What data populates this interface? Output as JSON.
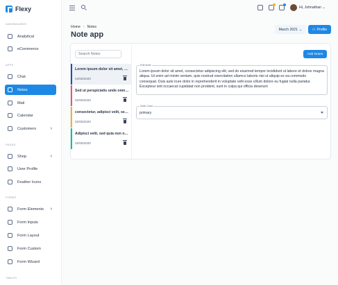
{
  "app": {
    "name": "Flexy"
  },
  "sidebar": {
    "sections": [
      "DASHBOARDS",
      "APPS",
      "PAGES",
      "FORMS",
      "TABLES"
    ],
    "items": [
      {
        "label": "Analytical"
      },
      {
        "label": "eCommerce"
      },
      {
        "label": "Chat"
      },
      {
        "label": "Notes",
        "active": true
      },
      {
        "label": "Mail"
      },
      {
        "label": "Calendar"
      },
      {
        "label": "Customers"
      },
      {
        "label": "Shop"
      },
      {
        "label": "User Profile"
      },
      {
        "label": "Feather Icons"
      },
      {
        "label": "Form Elements"
      },
      {
        "label": "Form Inputs"
      },
      {
        "label": "Form Layout"
      },
      {
        "label": "Form Custom"
      },
      {
        "label": "Form Wizard"
      }
    ]
  },
  "header": {
    "greeting": "Hi, Johnathan"
  },
  "page": {
    "breadcrumb": [
      "Home",
      "Notes"
    ],
    "title": "Note app",
    "month": "March 2021",
    "profile_label": "Profile"
  },
  "notes": {
    "search_placeholder": "Search Notes",
    "add_label": "Add Notes",
    "items": [
      {
        "title": "Lorem ipsum dolor sit amet, c...",
        "date": "04/06/2020",
        "color": "#1e4db7",
        "selected": true
      },
      {
        "title": "Sed ut perspiciatis unde omni...",
        "date": "02/06/2020",
        "color": "#fc4b6c"
      },
      {
        "title": "consectetur, adipisci velit, sed...",
        "date": "02/06/2020",
        "color": "#ffae1f"
      },
      {
        "title": "Adipisci velit, sed quia non nu...",
        "date": "02/06/2020",
        "color": "#00c292"
      }
    ],
    "editor": {
      "edit_label": "Edit Note",
      "text": "Lorem ipsum dolor sit amet, consectetur adipiscing elit, sed do eiusmod tempor incididunt ut labore et dolore magna aliqua. Ut enim ad minim veniam, quis nostrud exercitation ullamco laboris nisi ut aliquip ex ea commodo consequat. Duis aute irure dolor in reprehenderit in voluptate velit esse cillum dolore eu fugiat nulla pariatur. Excepteur sint occaecat cupidatat non proident, sunt in culpa qui officia deserunt",
      "color_label": "Note Color",
      "color_value": "primary"
    }
  },
  "colors": {
    "accent": "#1e88e5"
  }
}
